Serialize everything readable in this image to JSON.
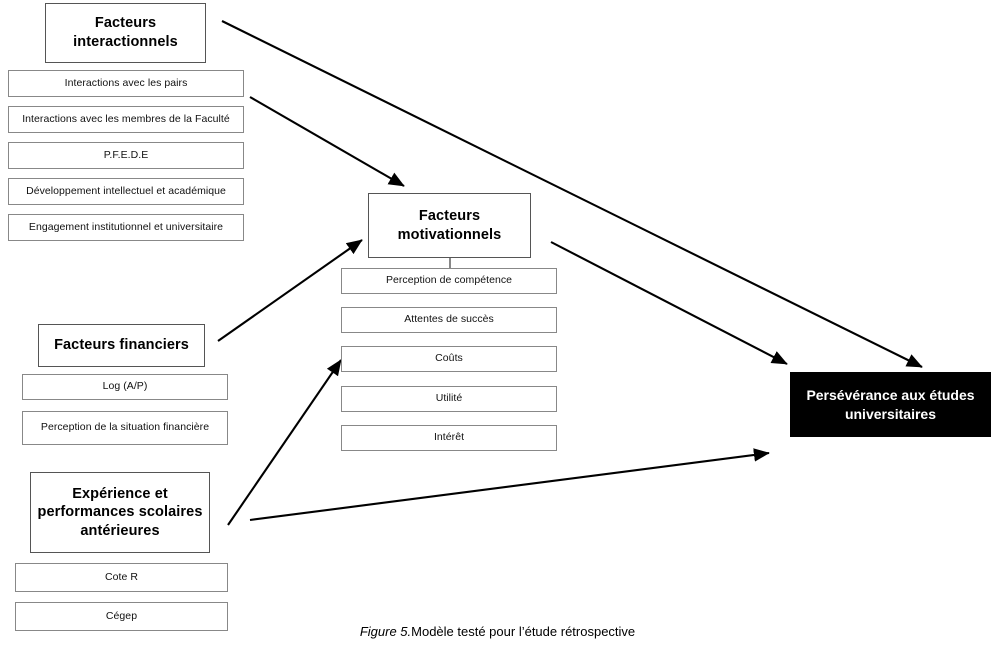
{
  "figure": {
    "caption_label": "Figure 5.",
    "caption_text": "Modèle testé pour l’étude rétrospective"
  },
  "colors": {
    "box_border": "#888888",
    "header_border": "#555555",
    "outcome_fill": "#000000",
    "outcome_text": "#ffffff",
    "background": "#ffffff",
    "edge": "#000000"
  },
  "constructs": {
    "interactional": {
      "title": "Facteurs interactionnels",
      "title_line1": "Facteurs",
      "title_line2": "interactionnels",
      "indicators": [
        "Interactions avec les pairs",
        "Interactions avec les membres de la Faculté",
        "P.F.E.D.E",
        "Développement intellectuel et académique",
        "Engagement institutionnel et universitaire"
      ]
    },
    "motivational": {
      "title": "Facteurs motivationnels",
      "title_line1": "Facteurs",
      "title_line2": "motivationnels",
      "indicators": [
        "Perception de compétence",
        "Attentes de succès",
        "Coûts",
        "Utilité",
        "Intérêt"
      ]
    },
    "financial": {
      "title": "Facteurs financiers",
      "indicators": [
        "Log (A/P)",
        "Perception de la situation financière"
      ]
    },
    "experience": {
      "title": "Expérience et performances scolaires antérieures",
      "title_line1": "Expérience et",
      "title_line2": "performances scolaires",
      "title_line3": "antérieures",
      "indicators": [
        "Cote R",
        "Cégep"
      ]
    },
    "outcome": {
      "title": "Persévérance aux études universitaires",
      "title_line1": "Persévérance aux études",
      "title_line2": "universitaires"
    }
  },
  "edges": [
    {
      "id": "interactional-to-outcome",
      "from": "Facteurs interactionnels",
      "to": "Persévérance aux études universitaires"
    },
    {
      "id": "interactional-to-motivational",
      "from": "Facteurs interactionnels",
      "to": "Facteurs motivationnels"
    },
    {
      "id": "motivational-to-outcome",
      "from": "Facteurs motivationnels",
      "to": "Persévérance aux études universitaires"
    },
    {
      "id": "financial-to-motivational",
      "from": "Facteurs financiers",
      "to": "Facteurs motivationnels"
    },
    {
      "id": "experience-to-motivational",
      "from": "Expérience et performances scolaires antérieures",
      "to": "Facteurs motivationnels"
    },
    {
      "id": "experience-to-outcome",
      "from": "Expérience et performances scolaires antérieures",
      "to": "Persévérance aux études universitaires"
    }
  ]
}
